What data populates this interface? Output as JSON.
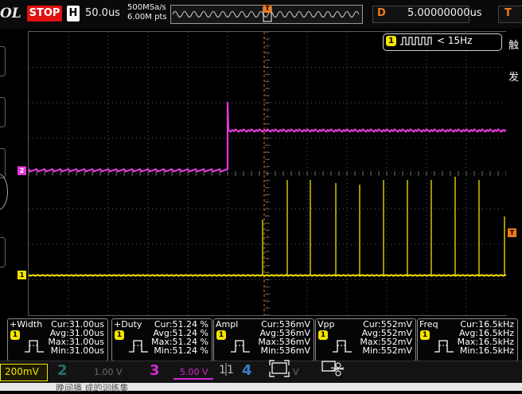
{
  "header": {
    "brand": "OL",
    "run_state": "STOP",
    "timebase_label": "H",
    "timebase_value": "50.0us",
    "sample_rate": "500MSa/s",
    "memory_depth": "6.00M pts",
    "trigger_position_marker": "T",
    "delay_label": "D",
    "delay_value": "5.00000000us",
    "trigger_label": "T"
  },
  "side_panel": {
    "chars": [
      "触",
      "发"
    ]
  },
  "trigger_pill": {
    "channel": "1",
    "condition": "< 15Hz"
  },
  "channel_markers": {
    "ch1": "1",
    "ch2": "2",
    "trigger_level": "T"
  },
  "measurements": [
    {
      "name": "+Width",
      "channel": "1",
      "cur": "Cur:31.00us",
      "avg": "Avg:31.00us",
      "max": "Max:31.00us",
      "min": "Min:31.00us"
    },
    {
      "name": "+Duty",
      "channel": "1",
      "cur": "Cur:51.24 %",
      "avg": "Avg:51.24 %",
      "max": "Max:51.24 %",
      "min": "Min:51.24 %"
    },
    {
      "name": "Ampl",
      "channel": "1",
      "cur": "Cur:536mV",
      "avg": "Avg:536mV",
      "max": "Max:536mV",
      "min": "Min:536mV"
    },
    {
      "name": "Vpp",
      "channel": "1",
      "cur": "Cur:552mV",
      "avg": "Avg:552mV",
      "max": "Max:552mV",
      "min": "Min:552mV"
    },
    {
      "name": "Freq",
      "channel": "1",
      "cur": "Cur:16.5kHz",
      "avg": "Avg:16.5kHz",
      "max": "Max:16.5kHz",
      "min": "Min:16.5kHz"
    }
  ],
  "bottom": {
    "ch1_scale": "200mV",
    "ch2_num": "2",
    "ch2_scale": "1.00 V",
    "ch3_num": "3",
    "ch3_scale": "5.00 V",
    "ch4_num": "4",
    "ch4_scale": "V",
    "footer_text": "晚间播        成的训练集"
  },
  "colors": {
    "ch1": "#f4e400",
    "ch2": "#e13ad6",
    "ch3": "#d02bd0",
    "ch4": "#3a7cc8",
    "trigger": "#f07a1c",
    "stop": "#e01212"
  }
}
